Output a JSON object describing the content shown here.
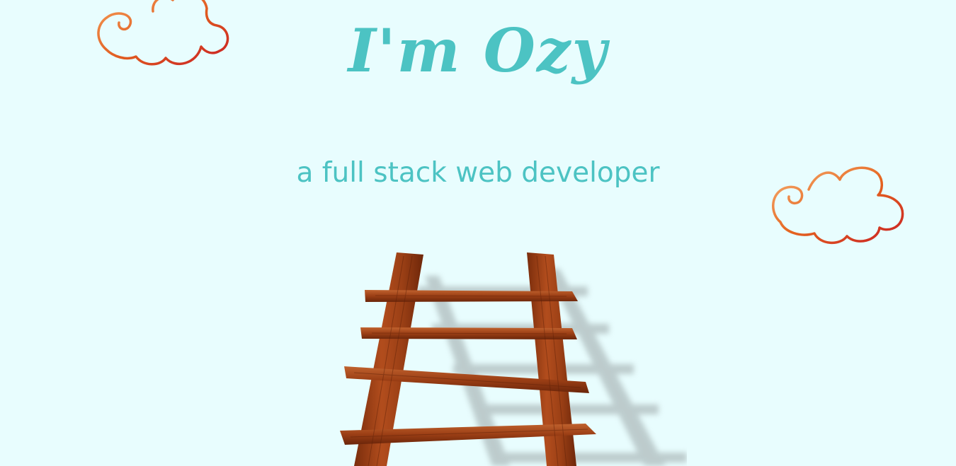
{
  "hero": {
    "title": "I'm Ozy",
    "subtitle": "a full stack web developer"
  },
  "colors": {
    "background": "#e8fdfe",
    "accent_text": "#4cc3c3",
    "cloud_outline_light": "#f6a15a",
    "cloud_outline_dark": "#c81e24",
    "ladder_wood": "#9b3d14"
  },
  "decorations": {
    "clouds": [
      "cloud-icon",
      "cloud-icon"
    ],
    "ladder": "ladder-illustration"
  }
}
